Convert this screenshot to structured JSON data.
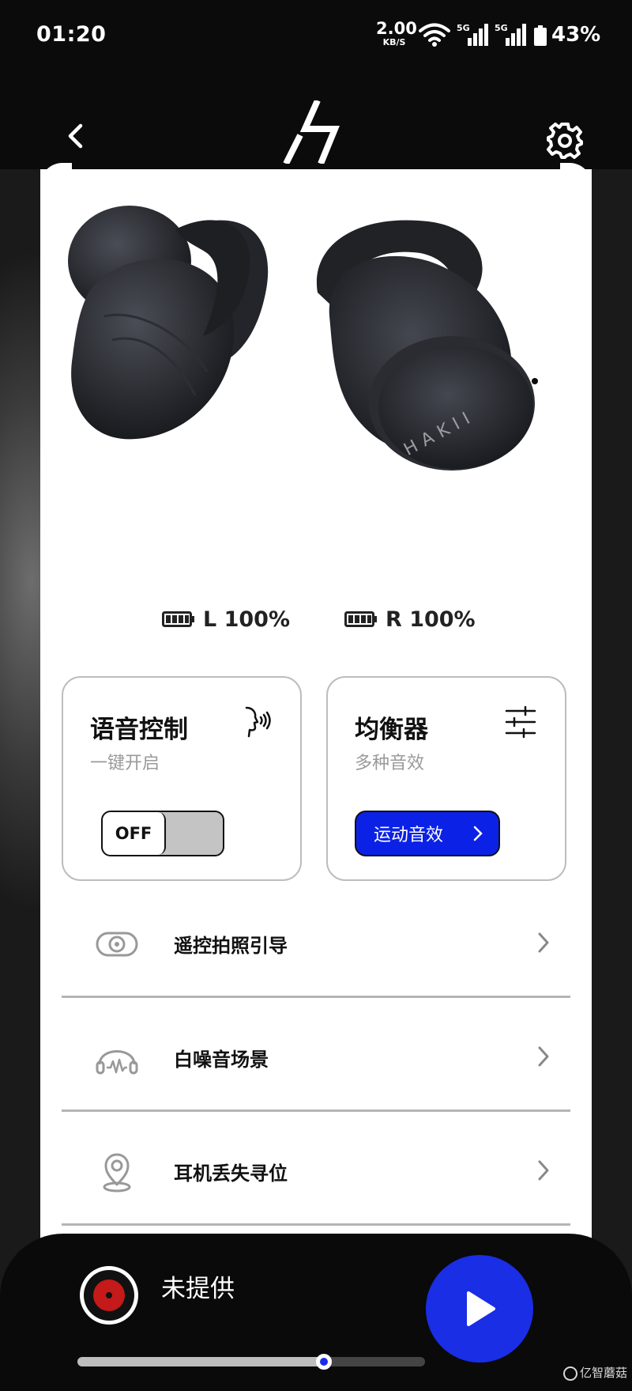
{
  "status_bar": {
    "time": "01:20",
    "net_speed_value": "2.00",
    "net_speed_unit": "KB/S",
    "signal_1_label": "5G",
    "signal_2_label": "5G",
    "battery_percent": "43%"
  },
  "header": {
    "back_icon": "chevron-left-icon",
    "logo": "brand-logo",
    "settings_icon": "gear-icon"
  },
  "battery": {
    "left_label": "L 100%",
    "right_label": "R 100%"
  },
  "voice_control": {
    "title": "语音控制",
    "subtitle": "一键开启",
    "toggle_state": "OFF"
  },
  "equalizer": {
    "title": "均衡器",
    "subtitle": "多种音效",
    "preset_button": "运动音效"
  },
  "menu": {
    "items": [
      {
        "label": "遥控拍照引导",
        "icon": "camera-icon"
      },
      {
        "label": "白噪音场景",
        "icon": "headphones-icon"
      },
      {
        "label": "耳机丢失寻位",
        "icon": "location-pin-icon"
      }
    ]
  },
  "player": {
    "track_title": "未提供",
    "progress": 0.71
  },
  "watermark": "亿智蘑菇",
  "colors": {
    "accent": "#0b22e6",
    "background": "#0b0b0b",
    "card": "#ffffff"
  }
}
